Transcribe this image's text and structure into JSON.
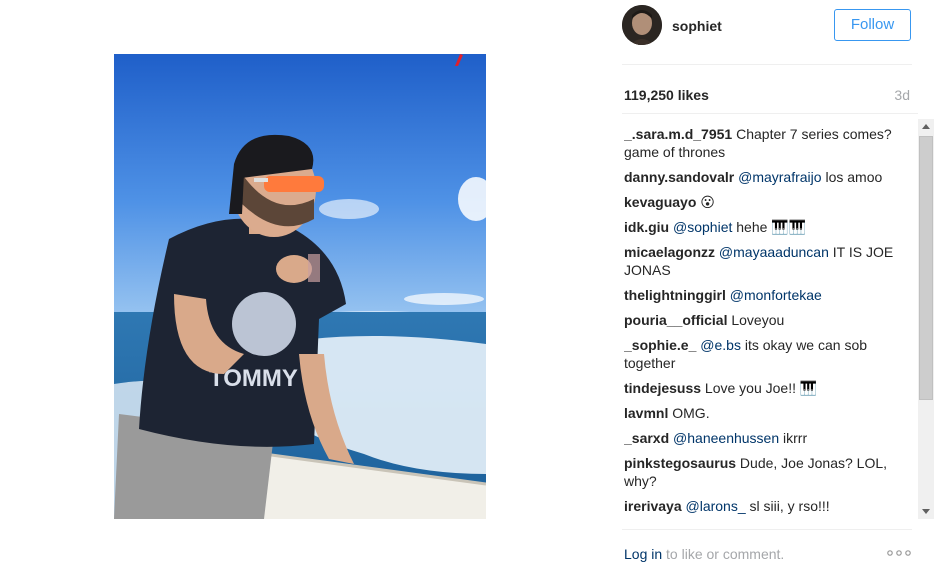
{
  "post": {
    "username": "sophiet",
    "follow_label": "Follow",
    "likes": "119,250 likes",
    "time": "3d"
  },
  "comments": [
    {
      "user": "_.sara.m.d_7951",
      "mention": "",
      "text": "Chapter 7 series comes?game of thrones"
    },
    {
      "user": "danny.sandovalr",
      "mention": "@mayrafraijo",
      "text": "los amoo"
    },
    {
      "user": "kevaguayo",
      "mention": "",
      "text": "😮"
    },
    {
      "user": "idk.giu",
      "mention": "@sophiet",
      "text": "hehe 🎹🎹"
    },
    {
      "user": "micaelagonzz",
      "mention": "@mayaaaduncan",
      "text": "IT IS JOE JONAS"
    },
    {
      "user": "thelightninggirl",
      "mention": "@monfortekae",
      "text": ""
    },
    {
      "user": "pouria__official",
      "mention": "",
      "text": "Loveyou"
    },
    {
      "user": "_sophie.e_",
      "mention": "@e.bs",
      "text": "its okay we can sob together"
    },
    {
      "user": "tindejesuss",
      "mention": "",
      "text": "Love you Joe!! 🎹"
    },
    {
      "user": "lavmnl",
      "mention": "",
      "text": "OMG."
    },
    {
      "user": "_sarxd",
      "mention": "@haneenhussen",
      "text": "ikrrr"
    },
    {
      "user": "pinkstegosaurus",
      "mention": "",
      "text": "Dude, Joe Jonas? LOL, why?"
    },
    {
      "user": "irerivaya",
      "mention": "@larons_",
      "text": "sl siii, y rso!!!"
    }
  ],
  "footer": {
    "login_link": "Log in",
    "login_rest": " to like or comment.",
    "more_icon": "ellipsis-icon"
  },
  "colors": {
    "follow_blue": "#3897f0",
    "mention_blue": "#003569",
    "muted_gray": "#a5a7aa"
  }
}
